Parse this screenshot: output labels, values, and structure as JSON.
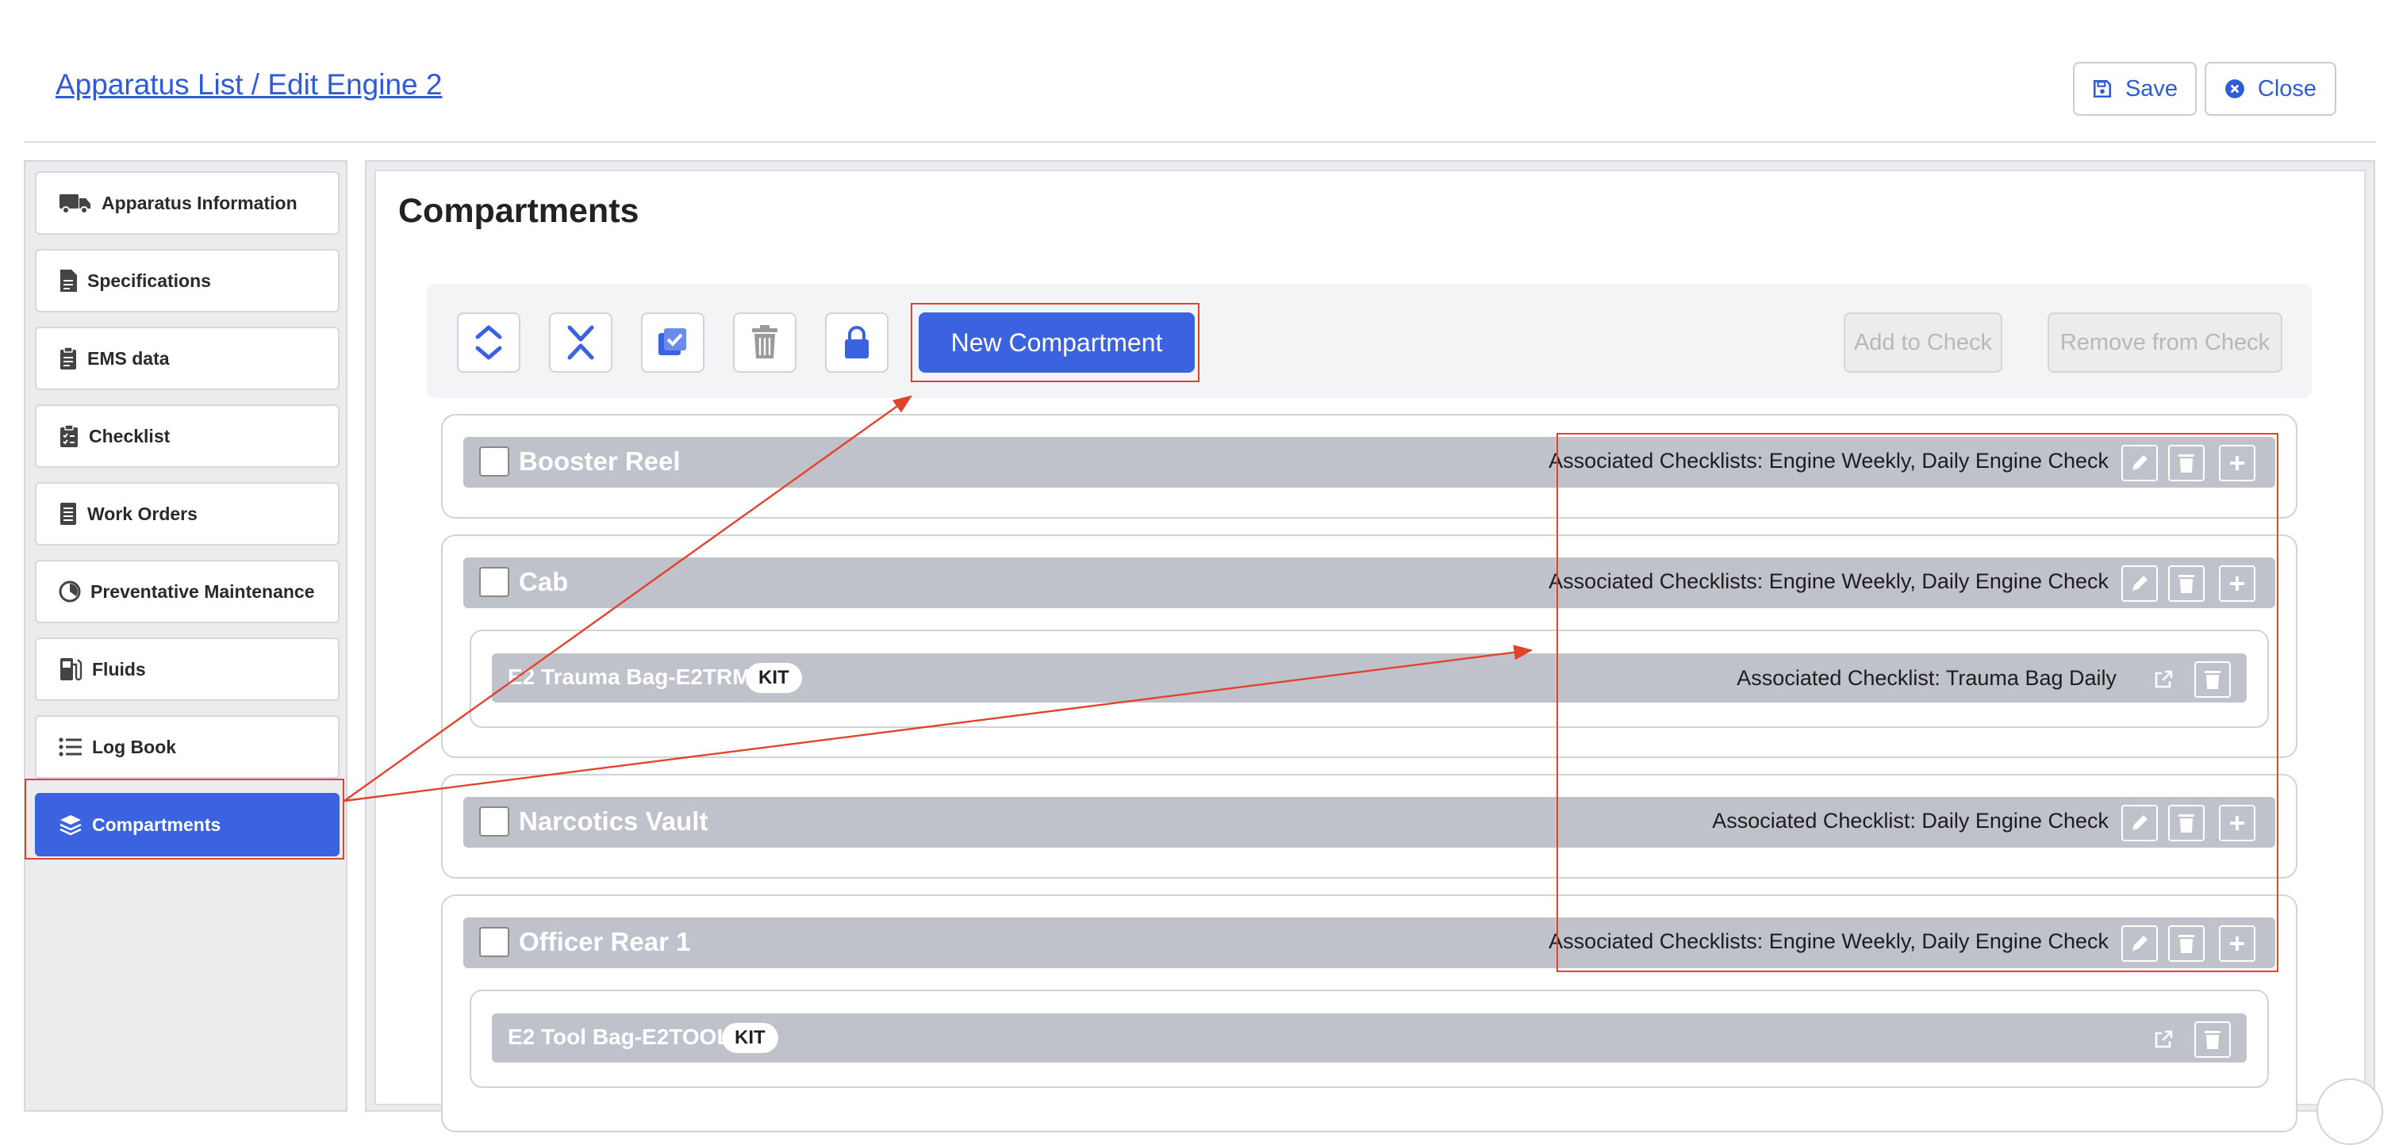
{
  "header": {
    "breadcrumb": "Apparatus List / Edit Engine 2",
    "save_label": "Save",
    "close_label": "Close"
  },
  "sidebar": {
    "items": [
      {
        "label": "Apparatus Information",
        "icon": "truck-icon"
      },
      {
        "label": "Specifications",
        "icon": "document-icon"
      },
      {
        "label": "EMS data",
        "icon": "clipboard-icon"
      },
      {
        "label": "Checklist",
        "icon": "clipboard-check-icon"
      },
      {
        "label": "Work Orders",
        "icon": "list-doc-icon"
      },
      {
        "label": "Preventative Maintenance",
        "icon": "gauge-icon"
      },
      {
        "label": "Fluids",
        "icon": "fuel-icon"
      },
      {
        "label": "Log Book",
        "icon": "list-icon"
      },
      {
        "label": "Compartments",
        "icon": "layers-icon",
        "active": true
      }
    ]
  },
  "main": {
    "title": "Compartments",
    "toolbar": {
      "new_compartment": "New Compartment",
      "add_to_check": "Add to Check",
      "remove_from_check": "Remove from Check"
    },
    "compartments": [
      {
        "name": "Booster Reel",
        "associated": "Associated Checklists: Engine Weekly, Daily Engine Check"
      },
      {
        "name": "Cab",
        "associated": "Associated Checklists: Engine Weekly, Daily Engine Check",
        "kits": [
          {
            "name": "E2 Trauma Bag-E2TRM",
            "badge": "KIT",
            "associated": "Associated Checklist: Trauma Bag Daily"
          }
        ]
      },
      {
        "name": "Narcotics Vault",
        "associated": "Associated Checklist: Daily Engine Check"
      },
      {
        "name": "Officer Rear 1",
        "associated": "Associated Checklists: Engine Weekly, Daily Engine Check",
        "kits": [
          {
            "name": "E2 Tool Bag-E2TOOL",
            "badge": "KIT",
            "associated": ""
          }
        ]
      }
    ]
  },
  "colors": {
    "accent": "#3b63e0",
    "annotation": "#e0442c",
    "bar": "#bfc1cb"
  }
}
